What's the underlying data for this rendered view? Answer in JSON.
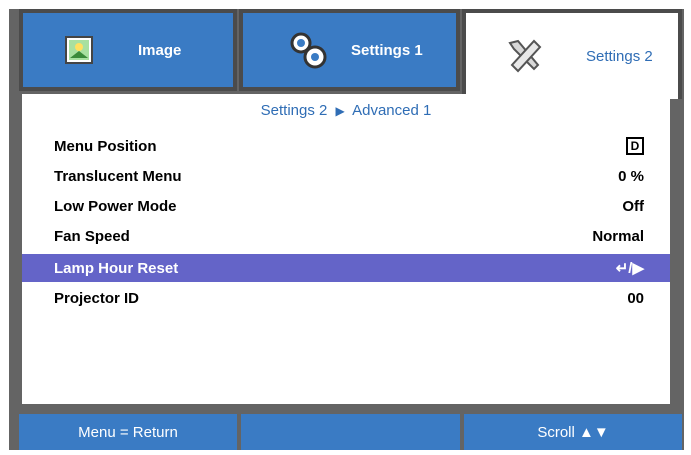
{
  "tabs": [
    {
      "label": "Image",
      "icon": "image-icon"
    },
    {
      "label": "Settings 1",
      "icon": "gears-icon"
    },
    {
      "label": "Settings 2",
      "icon": "tools-icon"
    }
  ],
  "breadcrumb": {
    "parent": "Settings 2",
    "separator": "▶",
    "current": "Advanced 1"
  },
  "rows": [
    {
      "label": "Menu Position",
      "value": "◘"
    },
    {
      "label": "Translucent Menu",
      "value": "0 %"
    },
    {
      "label": "Low Power Mode",
      "value": "Off"
    },
    {
      "label": "Fan Speed",
      "value": "Normal"
    },
    {
      "label": "Lamp Hour Reset",
      "value": "↵/▶"
    },
    {
      "label": "Projector ID",
      "value": "00"
    }
  ],
  "footer": {
    "left": "Menu = Return",
    "middle": "",
    "right": "Scroll ▲▼"
  },
  "colors": {
    "accent": "#3a7bc4",
    "selected": "#6464c8",
    "border": "#646464"
  }
}
